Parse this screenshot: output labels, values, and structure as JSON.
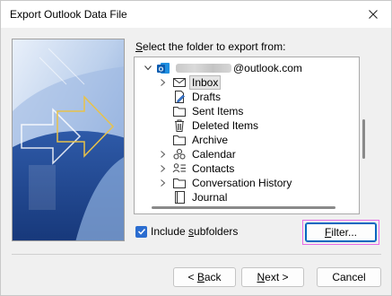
{
  "window": {
    "title": "Export Outlook Data File"
  },
  "prompt": {
    "before": "",
    "access_key": "S",
    "after": "elect the folder to export from:"
  },
  "tree": {
    "account_suffix": "@outlook.com",
    "items": [
      {
        "label": "Inbox",
        "icon": "envelope-icon",
        "expandable": true,
        "selected": true
      },
      {
        "label": "Drafts",
        "icon": "drafts-icon",
        "expandable": false
      },
      {
        "label": "Sent Items",
        "icon": "folder-icon",
        "expandable": false
      },
      {
        "label": "Deleted Items",
        "icon": "trash-icon",
        "expandable": false
      },
      {
        "label": "Archive",
        "icon": "folder-icon",
        "expandable": false
      },
      {
        "label": "Calendar",
        "icon": "calendar-icon",
        "expandable": true
      },
      {
        "label": "Contacts",
        "icon": "contacts-icon",
        "expandable": true
      },
      {
        "label": "Conversation History",
        "icon": "folder-icon",
        "expandable": true
      },
      {
        "label": "Journal",
        "icon": "journal-icon",
        "expandable": false
      }
    ]
  },
  "include_subfolders": {
    "before": "Include ",
    "access_key": "s",
    "after": "ubfolders",
    "checked": true
  },
  "buttons": {
    "filter": {
      "access_key": "F",
      "after": "ilter..."
    },
    "back": {
      "prefix": "< ",
      "access_key": "B",
      "after": "ack"
    },
    "next": {
      "access_key": "N",
      "after": "ext >"
    },
    "cancel": {
      "label": "Cancel"
    }
  },
  "colors": {
    "accent": "#2b6dd0",
    "focus_highlight": "#e66be6",
    "selection": "#e5e5e5"
  }
}
